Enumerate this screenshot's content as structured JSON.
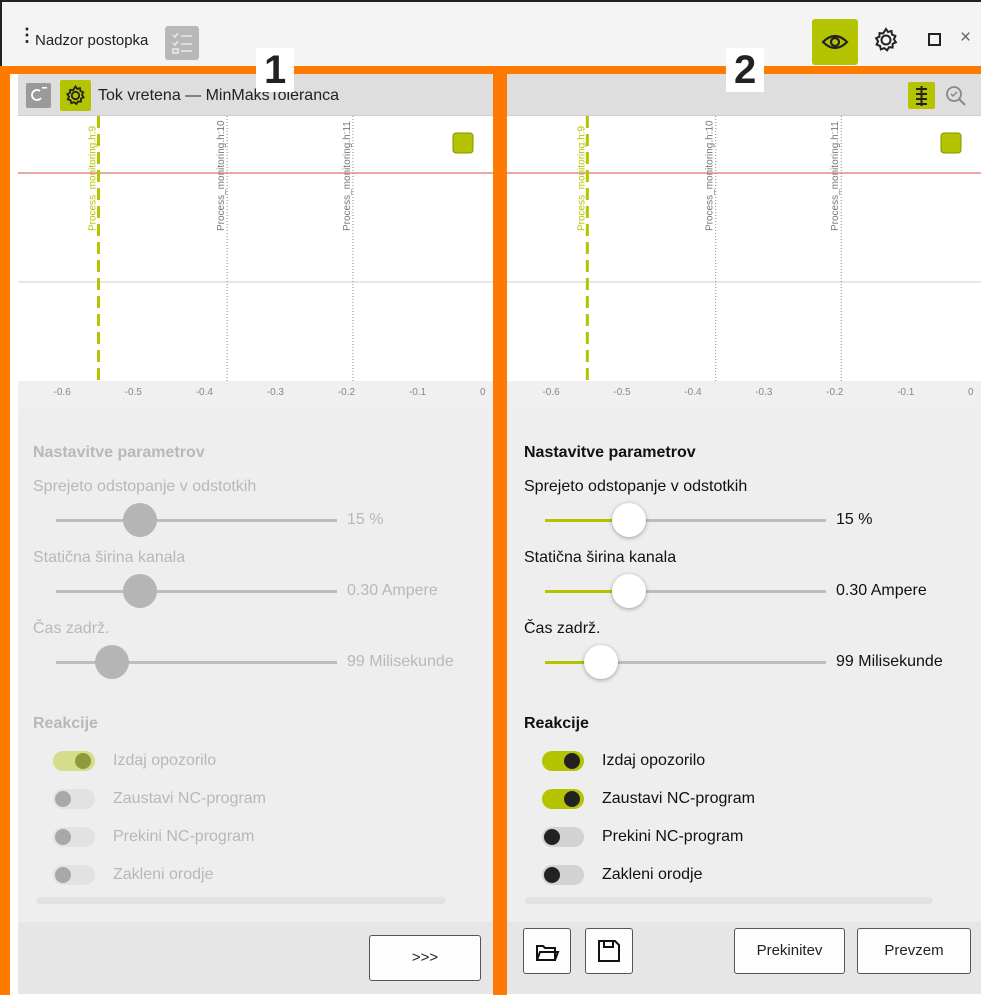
{
  "app": {
    "title": "Nadzor postopka",
    "menu_glyph": "⋮",
    "close_glyph": "×",
    "icons": [
      "menu-dots-icon",
      "list-icon",
      "eye-icon",
      "gear-icon",
      "maximize-icon",
      "close-icon"
    ]
  },
  "labels": {
    "left": "1",
    "right": "2"
  },
  "colors": {
    "accent": "#b5c400",
    "frame": "#ff7a00",
    "series_blue": "#5ab0e6",
    "upper_limit": "#e07070"
  },
  "left_panel": {
    "title": "Tok vretena — MinMaksToleranca",
    "icons": [
      "monitor-icon",
      "gear-icon"
    ],
    "state": "disabled",
    "chart_data": {
      "type": "line",
      "x_ticks": [
        "-0.6",
        "-0.5",
        "-0.4",
        "-0.3",
        "-0.2",
        "-0.1",
        "0"
      ],
      "xlim": [
        -0.65,
        0.0
      ],
      "markers": [
        {
          "label": "Process_monitoring.h:9",
          "x": -0.548,
          "style": "dashed",
          "color": "#b5c400"
        },
        {
          "label": "Process_monitoring.h:10",
          "x": -0.367,
          "style": "dotted",
          "color": "#888888"
        },
        {
          "label": "Process_monitoring.h:11",
          "x": -0.19,
          "style": "dotted",
          "color": "#888888"
        }
      ],
      "reference_lines": [
        "upper-limit",
        "middle"
      ],
      "series_color": "#5ab0e6"
    },
    "settings_title": "Nastavitve parametrov",
    "params": [
      {
        "label": "Sprejeto odstopanje v odstotkih",
        "value": "15 %",
        "fraction": 0.3
      },
      {
        "label": "Statična širina kanala",
        "value": "0.30 Ampere",
        "fraction": 0.3
      },
      {
        "label": "Čas zadrž.",
        "value": "99 Milisekunde",
        "fraction": 0.2
      }
    ],
    "reactions_title": "Reakcije",
    "reactions": [
      {
        "label": "Izdaj opozorilo",
        "on": true
      },
      {
        "label": "Zaustavi NC-program",
        "on": false
      },
      {
        "label": "Prekini NC-program",
        "on": false
      },
      {
        "label": "Zakleni orodje",
        "on": false
      }
    ],
    "footer_button": ">>>"
  },
  "right_panel": {
    "icons": [
      "list-view-icon",
      "zoom-icon"
    ],
    "state": "enabled",
    "chart_data": {
      "type": "line",
      "x_ticks": [
        "-0.6",
        "-0.5",
        "-0.4",
        "-0.3",
        "-0.2",
        "-0.1",
        "0"
      ],
      "xlim": [
        -0.65,
        0.0
      ],
      "markers": [
        {
          "label": "Process_monitoring.h:9",
          "x": -0.548,
          "style": "dashed",
          "color": "#b5c400"
        },
        {
          "label": "Process_monitoring.h:10",
          "x": -0.367,
          "style": "dotted",
          "color": "#888888"
        },
        {
          "label": "Process_monitoring.h:11",
          "x": -0.19,
          "style": "dotted",
          "color": "#888888"
        }
      ],
      "reference_lines": [
        "upper-limit",
        "middle"
      ],
      "series_color": "#5ab0e6"
    },
    "settings_title": "Nastavitve parametrov",
    "params": [
      {
        "label": "Sprejeto odstopanje v odstotkih",
        "value": "15 %",
        "fraction": 0.3
      },
      {
        "label": "Statična širina kanala",
        "value": "0.30 Ampere",
        "fraction": 0.3
      },
      {
        "label": "Čas zadrž.",
        "value": "99 Milisekunde",
        "fraction": 0.2
      }
    ],
    "reactions_title": "Reakcije",
    "reactions": [
      {
        "label": "Izdaj opozorilo",
        "on": true
      },
      {
        "label": "Zaustavi NC-program",
        "on": true
      },
      {
        "label": "Prekini NC-program",
        "on": false
      },
      {
        "label": "Zakleni orodje",
        "on": false
      }
    ],
    "footer_icons": [
      "open-file-icon",
      "save-icon"
    ],
    "cancel_label": "Prekinitev",
    "accept_label": "Prevzem"
  }
}
